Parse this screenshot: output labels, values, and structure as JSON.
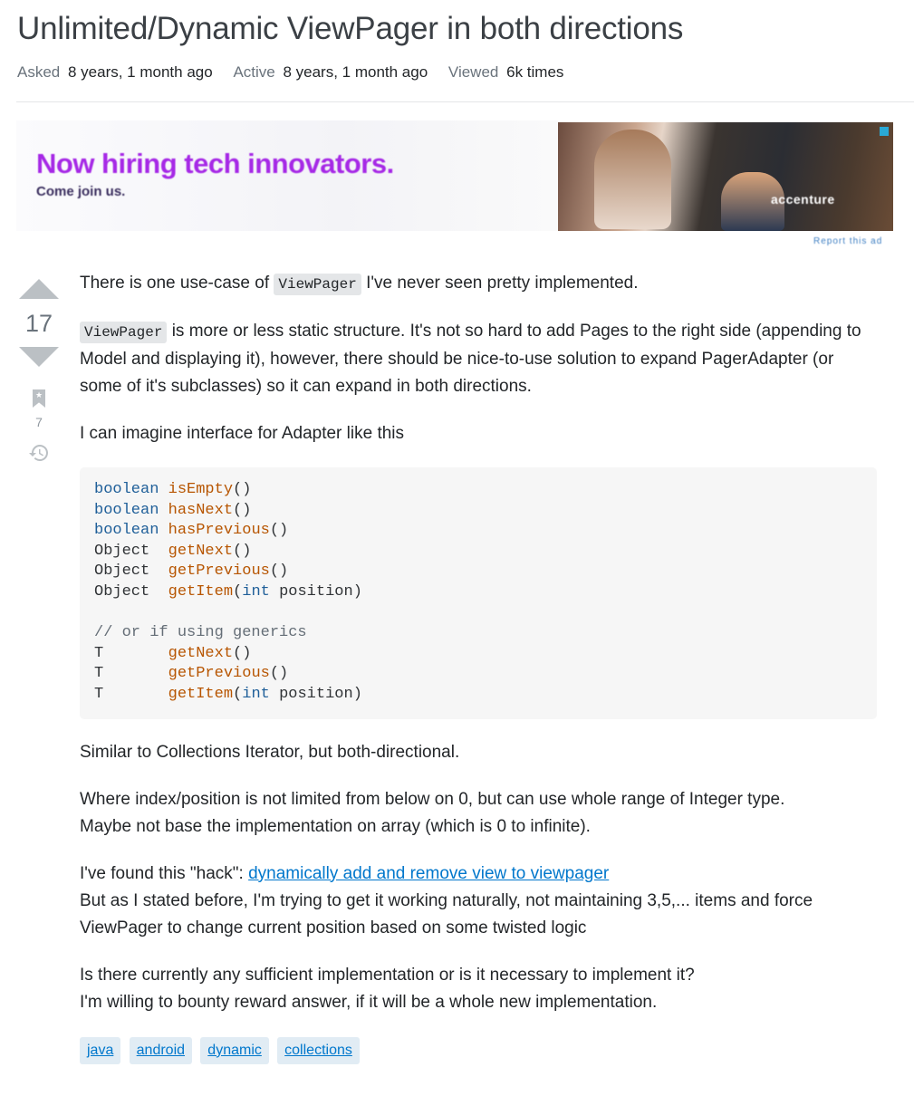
{
  "question": {
    "title": "Unlimited/Dynamic ViewPager in both directions",
    "asked_label": "Asked",
    "asked_value": "8 years, 1 month ago",
    "active_label": "Active",
    "active_value": "8 years, 1 month ago",
    "viewed_label": "Viewed",
    "viewed_value": "6k times"
  },
  "ad": {
    "headline": "Now hiring tech innovators.",
    "subline": "Come join us.",
    "logo_text": "accenture",
    "footer": "Report this ad"
  },
  "votes": {
    "score": "17",
    "bookmark_count": "7"
  },
  "body": {
    "p1_pre": "There is one use-case of ",
    "p1_code": "ViewPager",
    "p1_post": " I've never seen pretty implemented.",
    "p2_code": "ViewPager",
    "p2_text": " is more or less static structure. It's not so hard to add Pages to the right side (appending to Model and displaying it), however, there should be nice-to-use solution to expand PagerAdapter (or some of it's subclasses) so it can expand in both directions.",
    "p3": "I can imagine interface for Adapter like this",
    "code": {
      "kw_boolean": "boolean",
      "kw_int": "int",
      "t_object": "Object",
      "t_T": "T",
      "fn_isEmpty": "isEmpty",
      "fn_hasNext": "hasNext",
      "fn_hasPrevious": "hasPrevious",
      "fn_getNext": "getNext",
      "fn_getPrevious": "getPrevious",
      "fn_getItem": "getItem",
      "param": "position",
      "comment": "// or if using generics"
    },
    "p4": "Similar to Collections Iterator, but both-directional.",
    "p5_l1": "Where index/position is not limited from below on 0, but can use whole range of Integer type.",
    "p5_l2": "Maybe not base the implementation on array (which is 0 to infinite).",
    "p6_pre": "I've found this \"hack\": ",
    "p6_link": "dynamically add and remove view to viewpager",
    "p6_l2": "But as I stated before, I'm trying to get it working naturally, not maintaining 3,5,... items and force ViewPager to change current position based on some twisted logic",
    "p7_l1": "Is there currently any sufficient implementation or is it necessary to implement it?",
    "p7_l2": "I'm willing to bounty reward answer, if it will be a whole new implementation."
  },
  "tags": [
    "java",
    "android",
    "dynamic",
    "collections"
  ],
  "colors": {
    "tag_bg": "#e1ecf4",
    "tag_fg": "#39739d",
    "link": "#0077cc",
    "ad_accent": "#a629e6"
  }
}
